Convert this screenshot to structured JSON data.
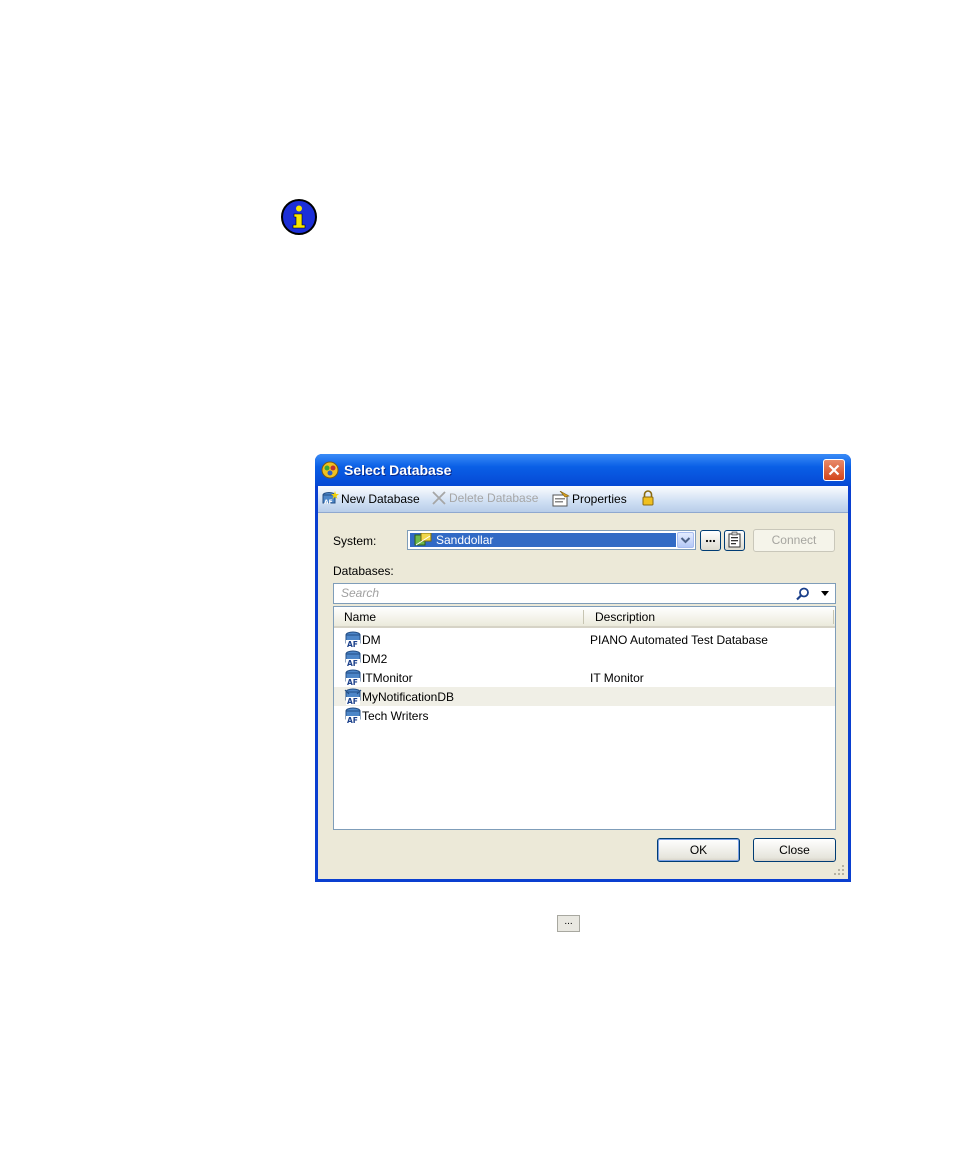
{
  "dialog": {
    "title": "Select Database",
    "toolbar": {
      "new_database": "New Database",
      "delete_database": "Delete Database",
      "properties": "Properties"
    },
    "system_label": "System:",
    "system_value": "Sanddollar",
    "ellipsis_label": "...",
    "connect_label": "Connect",
    "databases_label": "Databases:",
    "search_placeholder": "Search",
    "columns": {
      "name": "Name",
      "description": "Description"
    },
    "rows": [
      {
        "name": "DM",
        "description": "PIANO Automated Test Database"
      },
      {
        "name": "DM2",
        "description": ""
      },
      {
        "name": "ITMonitor",
        "description": "IT Monitor"
      },
      {
        "name": "MyNotificationDB",
        "description": ""
      },
      {
        "name": "Tech Writers",
        "description": ""
      }
    ],
    "ok_label": "OK",
    "close_label": "Close"
  },
  "inline_button_label": "...",
  "colors": {
    "title_bar": "#0a5fe6",
    "selection": "#316ac5",
    "info_icon": "#1c2fd8"
  }
}
